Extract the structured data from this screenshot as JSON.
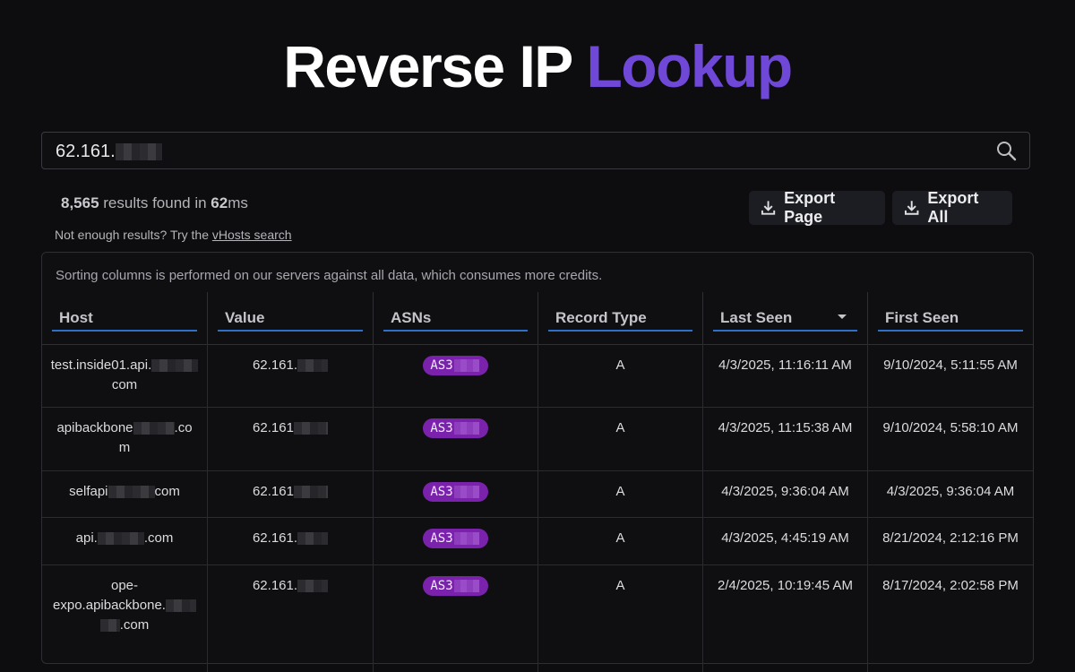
{
  "header": {
    "title_main": "Reverse IP",
    "title_accent": "Lookup"
  },
  "search": {
    "value": "62.161."
  },
  "stats": {
    "count": "8,565",
    "text_mid": " results found in ",
    "time": "62",
    "unit": "ms"
  },
  "hint": {
    "prefix": "Not enough results? Try the ",
    "link": "vHosts search"
  },
  "export": {
    "page_label": "Export Page",
    "all_label": "Export All"
  },
  "table": {
    "note": "Sorting columns is performed on our servers against all data, which consumes more credits.",
    "columns": [
      "Host",
      "Value",
      "ASNs",
      "Record Type",
      "Last Seen",
      "First Seen"
    ],
    "rows": [
      {
        "host_a": "test.inside01.api.",
        "host_b": "com",
        "value": "62.161.",
        "asn": "AS3",
        "type": "A",
        "last": "4/3/2025, 11:16:11 AM",
        "first": "9/10/2024, 5:11:55 AM"
      },
      {
        "host_a": "apibackbone",
        "host_b": ".co",
        "host_c": "m",
        "value": "62.161",
        "asn": "AS3",
        "type": "A",
        "last": "4/3/2025, 11:15:38 AM",
        "first": "9/10/2024, 5:58:10 AM"
      },
      {
        "host_a": "selfapi",
        "host_b": "com",
        "value": "62.161",
        "asn": "AS3",
        "type": "A",
        "last": "4/3/2025, 9:36:04 AM",
        "first": "4/3/2025, 9:36:04 AM"
      },
      {
        "host_a": "api.",
        "host_b": ".com",
        "value": "62.161.",
        "asn": "AS3",
        "type": "A",
        "last": "4/3/2025, 4:45:19 AM",
        "first": "8/21/2024, 2:12:16 PM"
      },
      {
        "host_a": "ope-",
        "host_b": "expo.apibackbone.",
        "host_c": ".com",
        "value": "62.161.",
        "asn": "AS3",
        "type": "A",
        "last": "2/4/2025, 10:19:45 AM",
        "first": "8/17/2024, 2:02:58 PM"
      }
    ]
  }
}
